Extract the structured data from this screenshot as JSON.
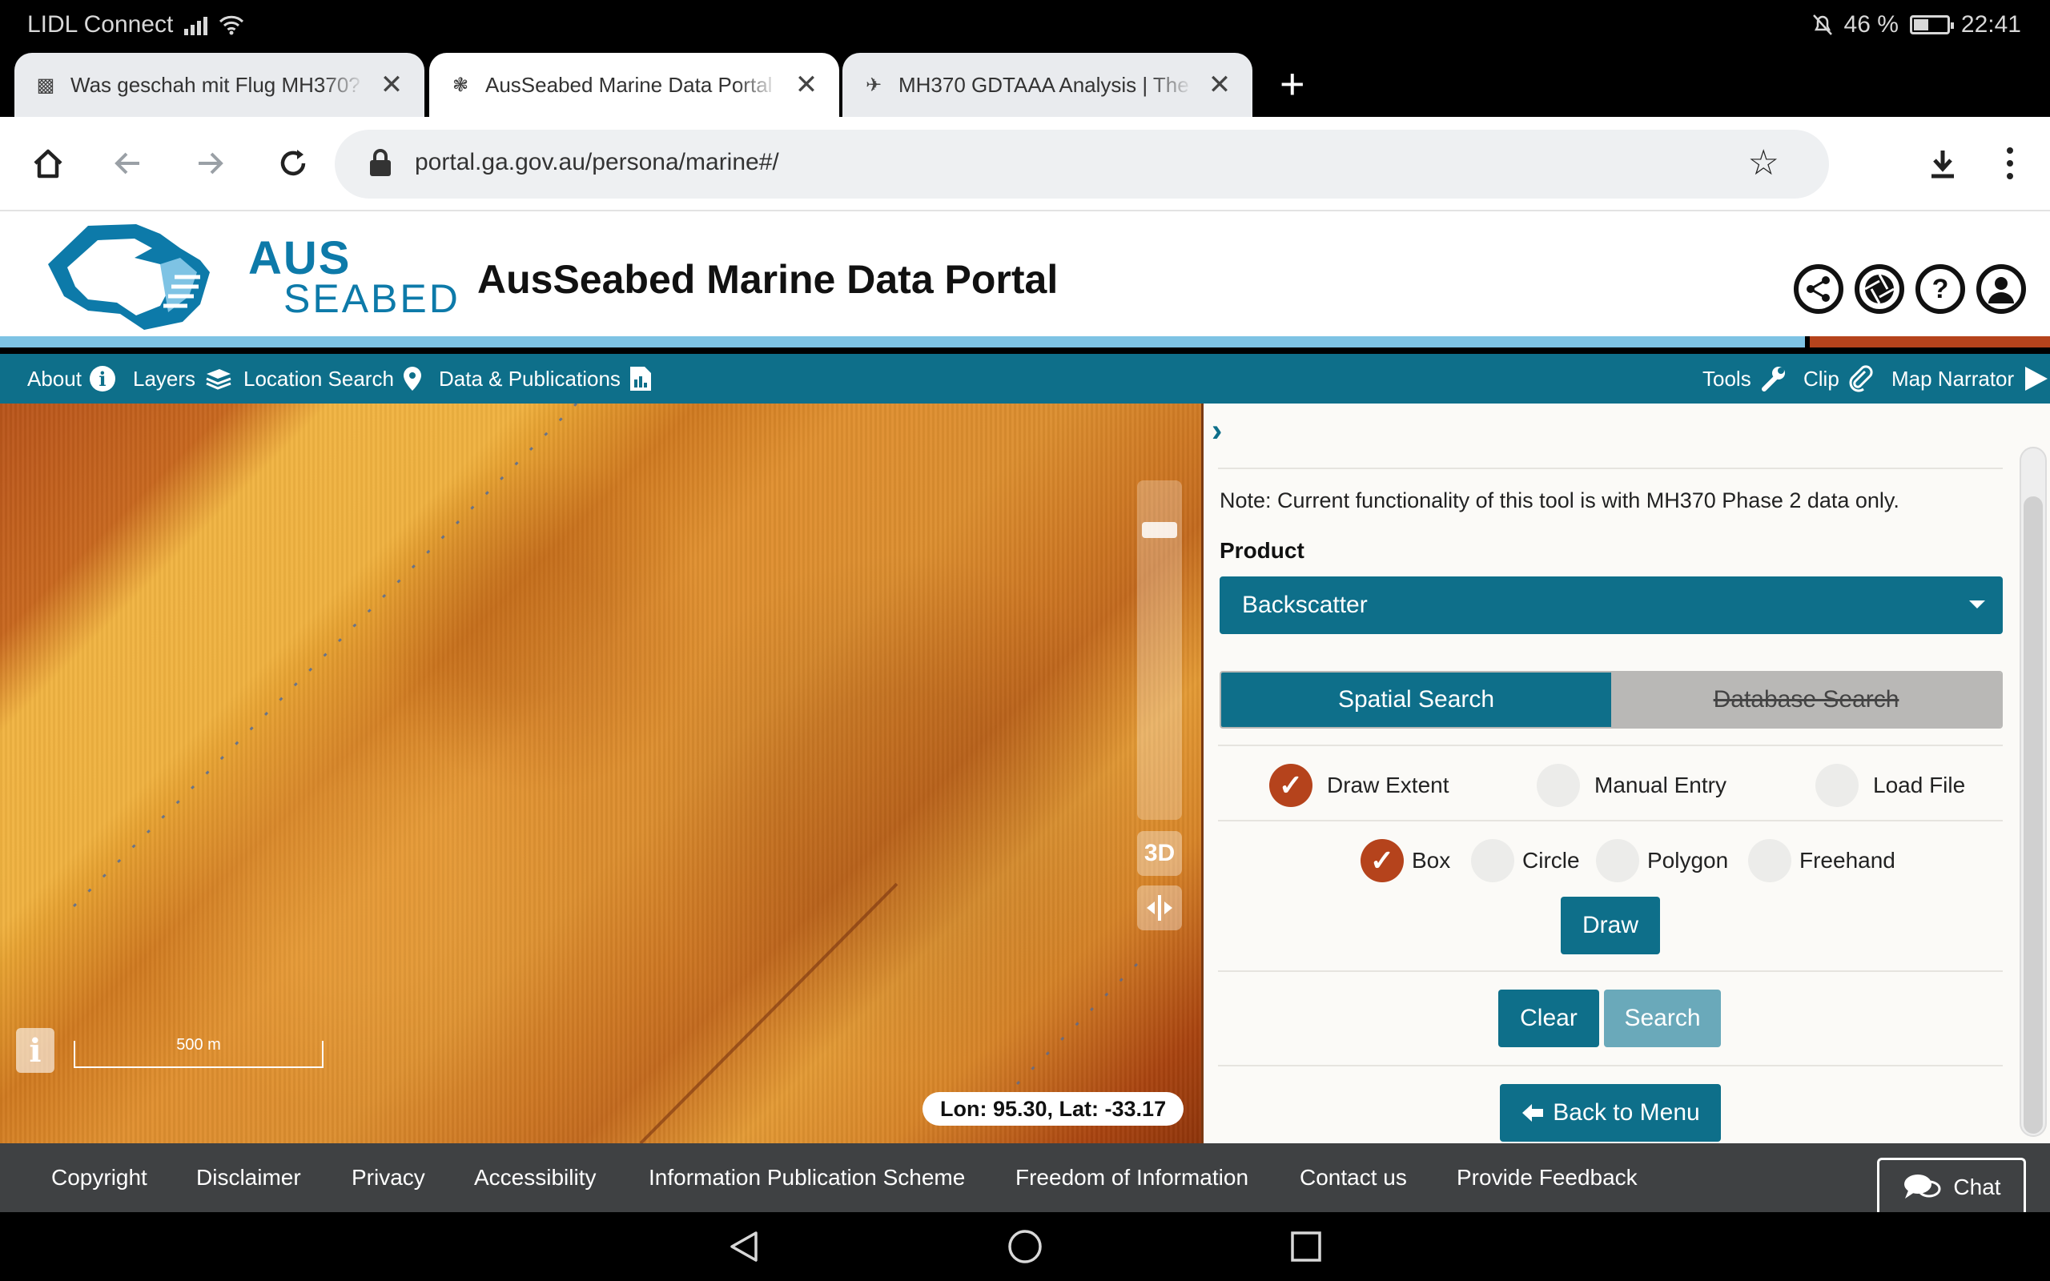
{
  "status_bar": {
    "carrier": "LIDL Connect",
    "battery": "46 %",
    "battery_level": 0.46,
    "time": "22:41"
  },
  "tabs": [
    {
      "title": "Was geschah mit Flug MH370? (S",
      "favicon": "document-icon"
    },
    {
      "title": "AusSeabed Marine Data Portal",
      "favicon": "ga-crest-icon",
      "active": true
    },
    {
      "title": "MH370 GDTAAA Analysis | The Se",
      "favicon": "plane-icon"
    }
  ],
  "address_bar": {
    "url": "portal.ga.gov.au/persona/marine#/"
  },
  "site": {
    "brand_top": "AUS",
    "brand_bottom": "SEABED",
    "title": "AusSeabed Marine Data Portal"
  },
  "nav": {
    "about": "About",
    "layers": "Layers",
    "location_search": "Location Search",
    "data_publications": "Data & Publications",
    "tools": "Tools",
    "clip": "Clip",
    "map_narrator": "Map Narrator"
  },
  "map": {
    "scale_label": "500 m",
    "coords": "Lon: 95.30, Lat: -33.17",
    "btn_3d": "3D",
    "info_btn": "i"
  },
  "panel": {
    "note": "Note: Current functionality of this tool is with MH370 Phase 2 data only.",
    "product_label": "Product",
    "product_value": "Backscatter",
    "tab_spatial": "Spatial Search",
    "tab_database": "Database Search",
    "mode_options": [
      "Draw Extent",
      "Manual Entry",
      "Load File"
    ],
    "shape_options": [
      "Box",
      "Circle",
      "Polygon",
      "Freehand"
    ],
    "draw": "Draw",
    "clear": "Clear",
    "search": "Search",
    "back": "Back to Menu"
  },
  "footer": {
    "links": [
      "Copyright",
      "Disclaimer",
      "Privacy",
      "Accessibility",
      "Information Publication Scheme",
      "Freedom of Information",
      "Contact us",
      "Provide Feedback"
    ],
    "chat": "Chat"
  },
  "colors": {
    "brand_teal": "#0e6f8a",
    "accent_red": "#b5431c",
    "light_blue": "#7ec3e4"
  }
}
